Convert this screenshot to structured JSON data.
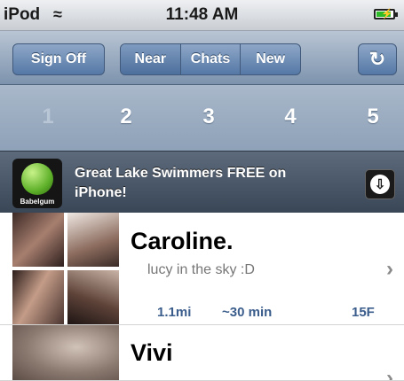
{
  "status_bar": {
    "carrier": "iPod",
    "wifi_icon": "wifi-icon",
    "time": "11:48 AM",
    "battery_icon": "battery-charging-icon",
    "battery_level": 0.8
  },
  "toolbar": {
    "sign_off_label": "Sign Off",
    "segments": [
      {
        "label": "Near",
        "selected": true
      },
      {
        "label": "Chats",
        "selected": false
      },
      {
        "label": "New",
        "selected": false
      }
    ],
    "refresh_icon": "refresh-icon"
  },
  "pages": {
    "numbers": [
      "1",
      "2",
      "3",
      "4",
      "5"
    ],
    "current": "1"
  },
  "ad": {
    "brand": "Babelgum",
    "text": "Great Lake Swimmers FREE on iPhone!",
    "download_icon": "download-icon"
  },
  "people": [
    {
      "name": "Caroline.",
      "status": "lucy in the sky :D",
      "distance": "1.1mi",
      "time": "~30 min",
      "age_gender": "15F"
    },
    {
      "name": "Vivi"
    }
  ]
}
